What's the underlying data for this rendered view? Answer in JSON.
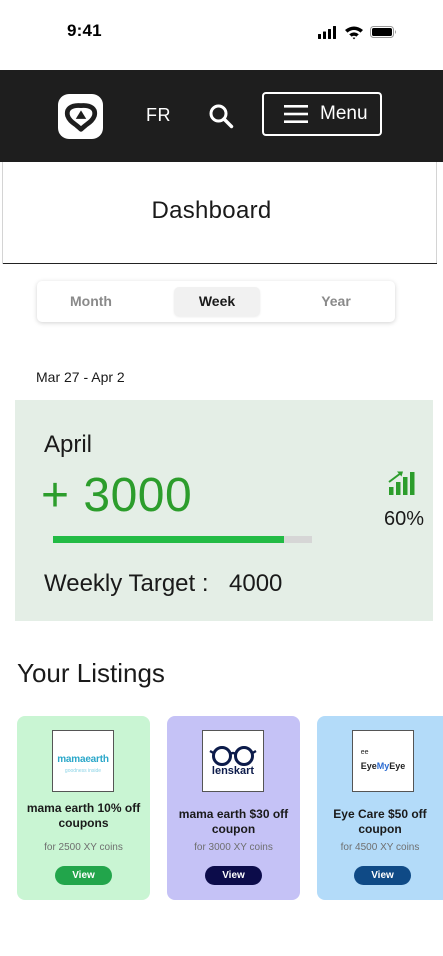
{
  "status_bar": {
    "time": "9:41"
  },
  "header": {
    "language": "FR",
    "menu_label": "Menu"
  },
  "page": {
    "title": "Dashboard"
  },
  "period_tabs": {
    "options": [
      "Month",
      "Week",
      "Year"
    ],
    "selected": "Week"
  },
  "summary": {
    "date_range": "Mar 27 - Apr 2",
    "month": "April",
    "amount": "+ 3000",
    "progress": 0.89,
    "growth_percent": "60%",
    "target_label": "Weekly Target :",
    "target_value": "4000"
  },
  "listings": {
    "title": "Your Listings",
    "items": [
      {
        "brand": "mamaearth",
        "brand_sub": "goodness inside",
        "name": "mama earth 10% off coupons",
        "coins": "for 2500 XY coins",
        "button": "View",
        "color": "#c9f5d3"
      },
      {
        "brand": "lenskart",
        "name": "mama earth $30 off coupon",
        "coins": "for 3000 XY coins",
        "button": "View",
        "color": "#c5c2f6"
      },
      {
        "brand_top": "ee",
        "brand_a": "Eye",
        "brand_b": "My",
        "brand_c": "Eye",
        "name": "Eye Care $50 off coupon",
        "coins": "for 4500 XY coins",
        "button": "View",
        "color": "#b3dbf9"
      }
    ]
  },
  "colors": {
    "header_bg": "#1e1e1e",
    "accent_green": "#2c9d2c",
    "progress_fill": "#22bb45",
    "card_bg": "#e4eee6"
  },
  "icons": [
    "cellular-signal-icon",
    "wifi-icon",
    "battery-icon",
    "trillium-logo-icon",
    "search-icon",
    "hamburger-menu-icon",
    "signal-growth-icon"
  ]
}
